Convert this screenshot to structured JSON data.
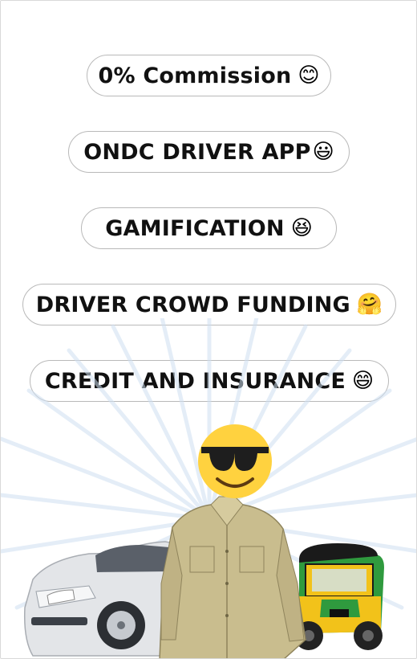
{
  "features": [
    {
      "label": "0% Commission",
      "emoji": "😊"
    },
    {
      "label": "ONDC DRIVER APP",
      "emoji": "😃"
    },
    {
      "label": "GAMIFICATION",
      "emoji": "😆"
    },
    {
      "label": "DRIVER CROWD FUNDING",
      "emoji": "🤗"
    },
    {
      "label": "CREDIT AND INSURANCE",
      "emoji": "😄"
    }
  ],
  "illustration": {
    "face_emoji": "😎",
    "icons": [
      "car-icon",
      "person-icon",
      "auto-rickshaw-icon"
    ]
  }
}
